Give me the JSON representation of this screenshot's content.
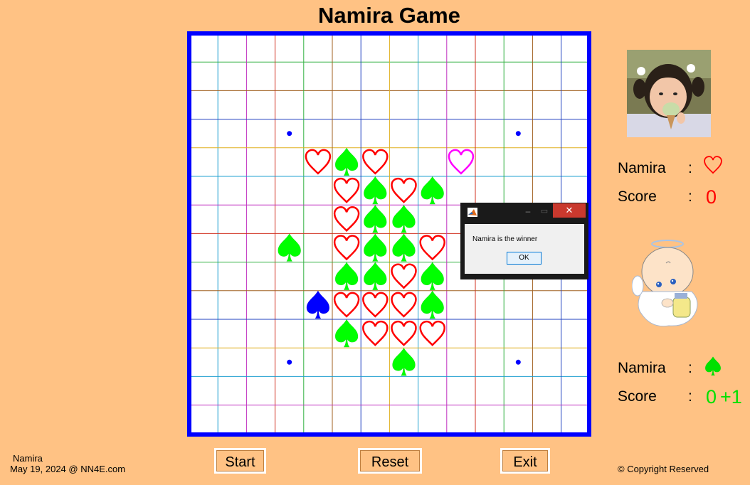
{
  "title": "Namira Game",
  "dialog": {
    "message": "Namira is the winner",
    "ok_label": "OK",
    "close_glyph": "✕",
    "min_glyph": "–",
    "max_glyph": "▭"
  },
  "player1": {
    "name": "Namira",
    "colon": ":",
    "symbol": "heart-outline-icon",
    "score_label": "Score",
    "score": "0",
    "color": "#FF0000"
  },
  "player2": {
    "name": "Namira",
    "colon": ":",
    "symbol": "spade-icon",
    "score_label": "Score",
    "score": "0",
    "bonus": "+1",
    "color": "#00E000"
  },
  "buttons": {
    "start": "Start",
    "reset": "Reset",
    "exit": "Exit"
  },
  "footer": {
    "name": "Namira",
    "date_site": "May 19, 2024 @ NN4E.com",
    "copyright": "© Copyright Reserved"
  },
  "board": {
    "grid_size": 14,
    "border_color": "#0000FF",
    "star_points": [
      [
        3,
        3
      ],
      [
        11,
        3
      ],
      [
        3,
        11
      ],
      [
        11,
        11
      ]
    ],
    "hearts_red": [
      [
        4,
        4
      ],
      [
        6,
        4
      ],
      [
        5,
        5
      ],
      [
        7,
        5
      ],
      [
        5,
        6
      ],
      [
        5,
        7
      ],
      [
        8,
        7
      ],
      [
        7,
        8
      ],
      [
        5,
        9
      ],
      [
        6,
        9
      ],
      [
        7,
        9
      ],
      [
        6,
        10
      ],
      [
        7,
        10
      ],
      [
        8,
        10
      ]
    ],
    "hearts_magenta": [
      [
        9,
        4
      ]
    ],
    "spades_green": [
      [
        5,
        4
      ],
      [
        6,
        5
      ],
      [
        8,
        5
      ],
      [
        6,
        6
      ],
      [
        7,
        6
      ],
      [
        3,
        7
      ],
      [
        6,
        7
      ],
      [
        7,
        7
      ],
      [
        5,
        8
      ],
      [
        6,
        8
      ],
      [
        8,
        8
      ],
      [
        8,
        9
      ],
      [
        5,
        10
      ],
      [
        7,
        11
      ]
    ],
    "spades_blue": [
      [
        4,
        9
      ]
    ],
    "colors": {
      "heart_red": "#FF0000",
      "heart_magenta": "#FF00FF",
      "spade_green": "#00FF00",
      "spade_blue": "#0000FF"
    }
  }
}
